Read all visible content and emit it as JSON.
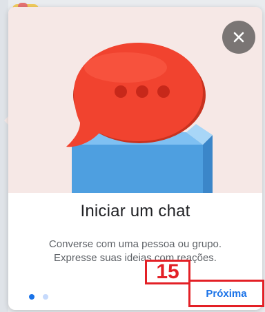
{
  "popup": {
    "title": "Iniciar um chat",
    "description_lines": [
      "Converse com uma pessoa ou grupo.",
      "Expresse suas ideias com reações."
    ],
    "next_label": "Próxima",
    "pagination": {
      "current": 1,
      "total": 2
    }
  },
  "annotation": {
    "step_number": "15",
    "color": "#e32026"
  },
  "colors": {
    "hero_background": "#f6e8e6",
    "bubble": "#f1432f",
    "cube": "#4e9fe0",
    "accent": "#1a73e8",
    "close_button": "#7a7574"
  },
  "icons": {
    "close": "close-icon",
    "hero": "chat-bubble-illustration"
  }
}
